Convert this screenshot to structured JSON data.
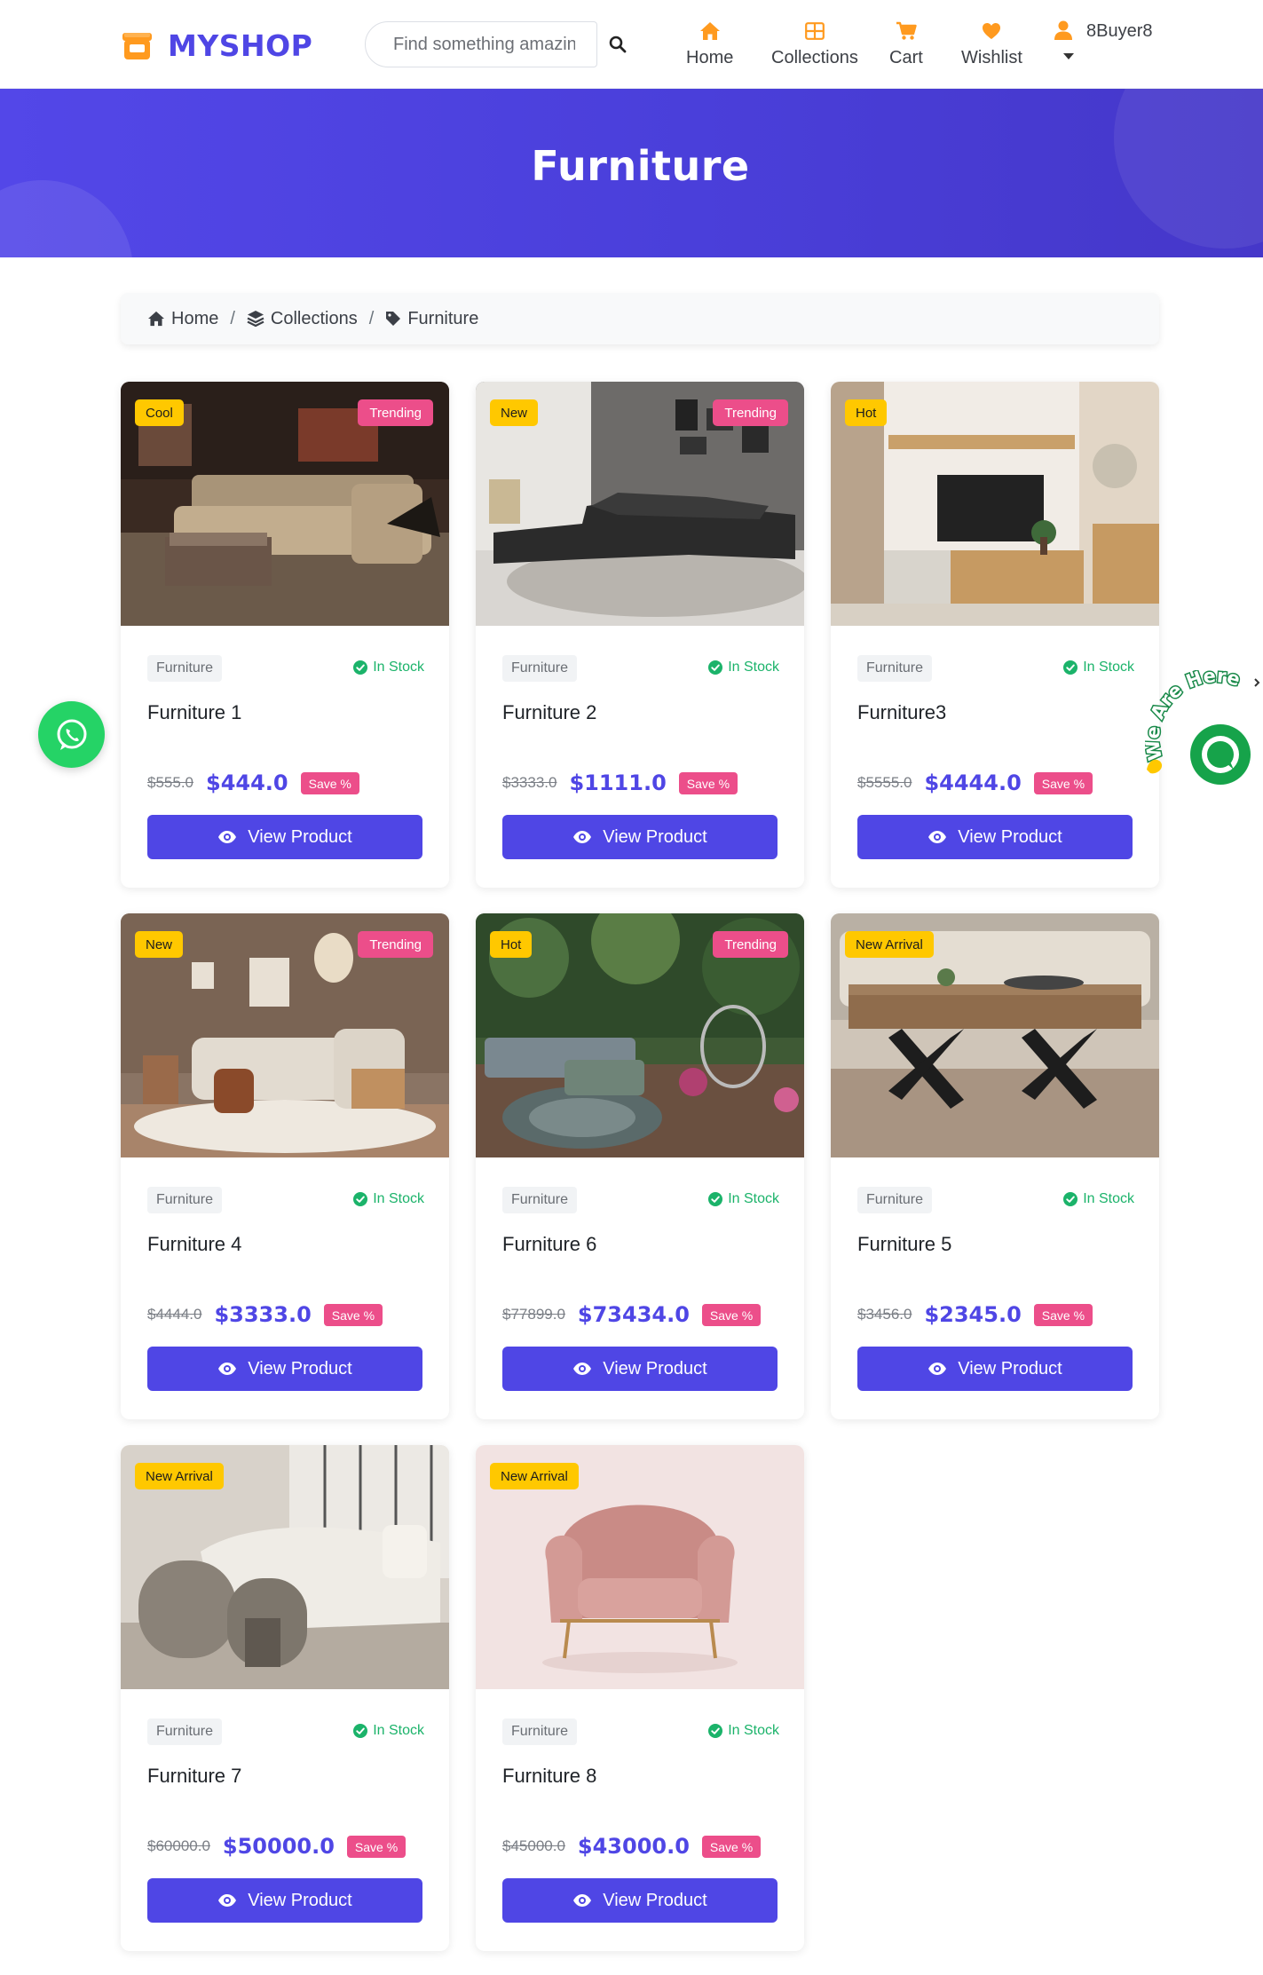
{
  "brand": {
    "name": "MYSHOP"
  },
  "search": {
    "placeholder": "Find something amazing"
  },
  "nav": {
    "home": "Home",
    "collections": "Collections",
    "cart": "Cart",
    "wishlist": "Wishlist",
    "user": "8Buyer8"
  },
  "hero": {
    "title": "Furniture"
  },
  "breadcrumb": {
    "home": "Home",
    "collections": "Collections",
    "current": "Furniture"
  },
  "common": {
    "stock_label": "In Stock",
    "save_label": "Save %",
    "view_label": "View Product"
  },
  "colors": {
    "primary": "#4f46e5",
    "badge_yellow": "#ffc800",
    "badge_pink": "#ec4e8a",
    "stock_green": "#1bb36a",
    "whatsapp": "#25d366"
  },
  "products": [
    {
      "category": "Furniture",
      "title": "Furniture 1",
      "old_price": "$555.0",
      "price": "$444.0",
      "badge_left": "Cool",
      "badge_right": "Trending"
    },
    {
      "category": "Furniture",
      "title": "Furniture 2",
      "old_price": "$3333.0",
      "price": "$1111.0",
      "badge_left": "New",
      "badge_right": "Trending"
    },
    {
      "category": "Furniture",
      "title": "Furniture3",
      "old_price": "$5555.0",
      "price": "$4444.0",
      "badge_left": "Hot",
      "badge_right": ""
    },
    {
      "category": "Furniture",
      "title": "Furniture 4",
      "old_price": "$4444.0",
      "price": "$3333.0",
      "badge_left": "New",
      "badge_right": "Trending"
    },
    {
      "category": "Furniture",
      "title": "Furniture 6",
      "old_price": "$77899.0",
      "price": "$73434.0",
      "badge_left": "Hot",
      "badge_right": "Trending"
    },
    {
      "category": "Furniture",
      "title": "Furniture 5",
      "old_price": "$3456.0",
      "price": "$2345.0",
      "badge_left": "New Arrival",
      "badge_right": ""
    },
    {
      "category": "Furniture",
      "title": "Furniture 7",
      "old_price": "$60000.0",
      "price": "$50000.0",
      "badge_left": "New Arrival",
      "badge_right": ""
    },
    {
      "category": "Furniture",
      "title": "Furniture 8",
      "old_price": "$45000.0",
      "price": "$43000.0",
      "badge_left": "New Arrival",
      "badge_right": ""
    }
  ],
  "chat_widget": {
    "text": "We Are Here"
  }
}
